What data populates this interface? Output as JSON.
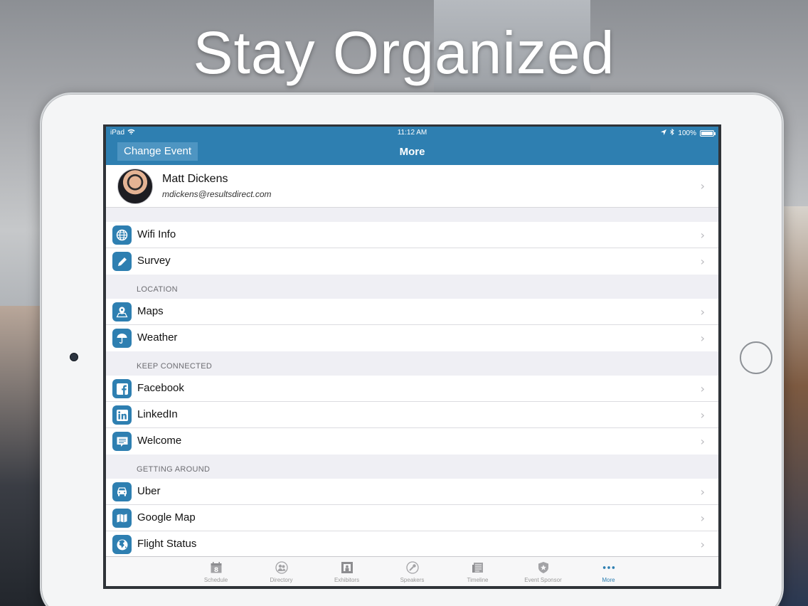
{
  "hero": {
    "title": "Stay Organized"
  },
  "statusbar": {
    "device": "iPad",
    "time": "11:12 AM",
    "battery": "100%"
  },
  "navbar": {
    "left_button": "Change Event",
    "title": "More"
  },
  "profile": {
    "name": "Matt Dickens",
    "email": "mdickens@resultsdirect.com"
  },
  "sections": [
    {
      "header": "",
      "items": [
        {
          "label": "Wifi Info",
          "icon": "globe-icon"
        },
        {
          "label": "Survey",
          "icon": "pencil-icon"
        }
      ]
    },
    {
      "header": "LOCATION",
      "items": [
        {
          "label": "Maps",
          "icon": "map-pin-icon"
        },
        {
          "label": "Weather",
          "icon": "umbrella-icon"
        }
      ]
    },
    {
      "header": "KEEP CONNECTED",
      "items": [
        {
          "label": "Facebook",
          "icon": "facebook-icon"
        },
        {
          "label": "LinkedIn",
          "icon": "linkedin-icon"
        },
        {
          "label": "Welcome",
          "icon": "message-icon"
        }
      ]
    },
    {
      "header": "GETTING AROUND",
      "items": [
        {
          "label": "Uber",
          "icon": "car-icon"
        },
        {
          "label": "Google Map",
          "icon": "folded-map-icon"
        },
        {
          "label": "Flight Status",
          "icon": "earth-icon"
        }
      ]
    }
  ],
  "tabs": [
    {
      "label": "Schedule",
      "icon": "calendar-icon"
    },
    {
      "label": "Directory",
      "icon": "people-icon"
    },
    {
      "label": "Exhibitors",
      "icon": "booth-icon"
    },
    {
      "label": "Speakers",
      "icon": "microphone-icon"
    },
    {
      "label": "Timeline",
      "icon": "newspaper-icon"
    },
    {
      "label": "Event Sponsor",
      "icon": "shield-star-icon"
    },
    {
      "label": "More",
      "icon": "more-dots-icon",
      "active": true
    }
  ],
  "colors": {
    "accent": "#2e7fb1",
    "background": "#efeff4"
  }
}
